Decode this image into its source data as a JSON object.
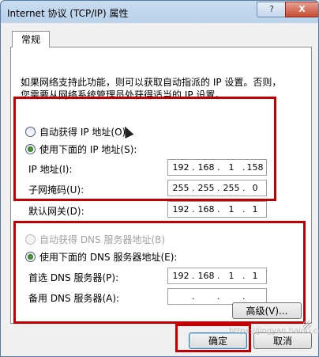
{
  "window": {
    "title": "Internet 协议 (TCP/IP) 属性",
    "help_btn": "?",
    "close_btn": "X"
  },
  "tab": {
    "label": "常规"
  },
  "description": "如果网络支持此功能，则可以获取自动指派的 IP 设置。否则，\n您需要从网络系统管理员处获得适当的 IP 设置。",
  "ip_section": {
    "auto_label": "自动获得 IP 地址(O)",
    "manual_label": "使用下面的 IP 地址(S):",
    "auto_selected": false,
    "manual_selected": true,
    "fields": [
      {
        "label": "IP 地址(I):",
        "octets": [
          "192",
          "168",
          "1",
          "158"
        ]
      },
      {
        "label": "子网掩码(U):",
        "octets": [
          "255",
          "255",
          "255",
          "0"
        ]
      },
      {
        "label": "默认网关(D):",
        "octets": [
          "192",
          "168",
          "1",
          "1"
        ]
      }
    ]
  },
  "dns_section": {
    "auto_label": "自动获得 DNS 服务器地址(B)",
    "manual_label": "使用下面的 DNS 服务器地址(E):",
    "auto_enabled": false,
    "manual_selected": true,
    "fields": [
      {
        "label": "首选 DNS 服务器(P):",
        "octets": [
          "192",
          "168",
          "1",
          "1"
        ]
      },
      {
        "label": "备用 DNS 服务器(A):",
        "octets": [
          "",
          "",
          "",
          ""
        ]
      }
    ]
  },
  "advanced_btn": "高级(V)...",
  "ok_btn": "确定",
  "cancel_btn": "取消",
  "watermark": "https://jingyan.baidu.com",
  "highlight_color": "#c00000"
}
